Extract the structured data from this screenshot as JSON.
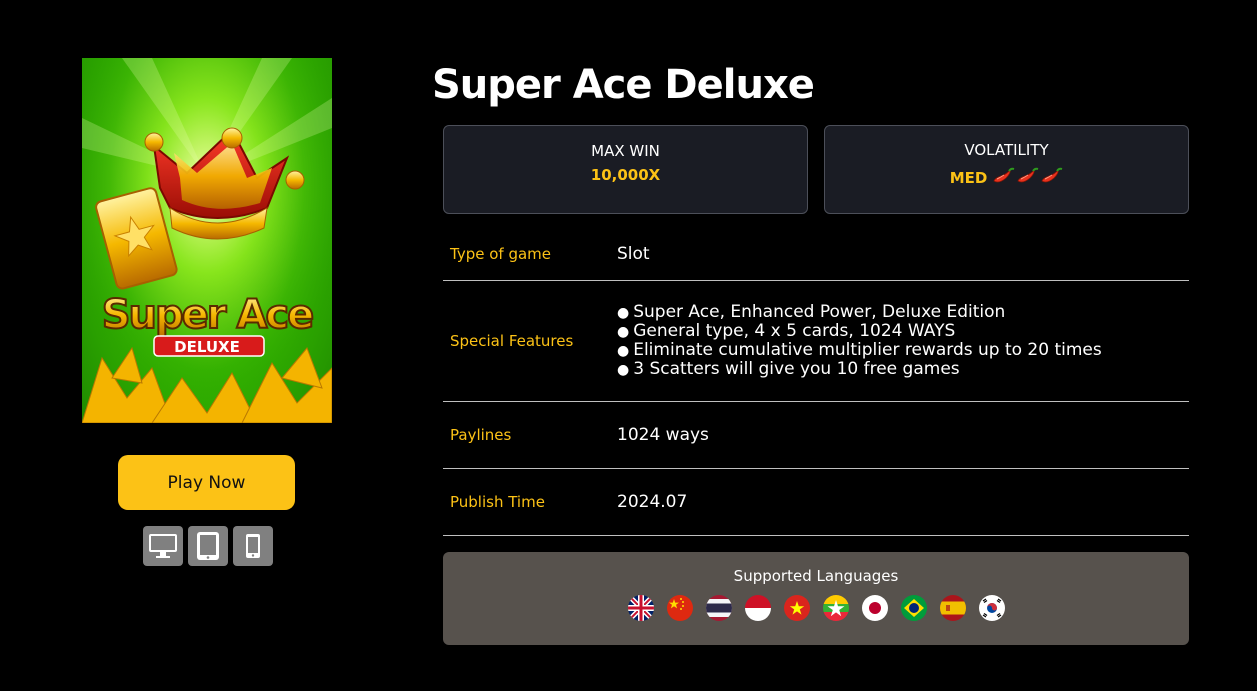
{
  "game": {
    "title": "Super Ace Deluxe",
    "cover_text_main": "Super Ace",
    "cover_text_sub": "DELUXE"
  },
  "actions": {
    "play_label": "Play Now"
  },
  "devices": [
    {
      "name": "desktop-icon"
    },
    {
      "name": "tablet-icon"
    },
    {
      "name": "mobile-icon"
    }
  ],
  "stats": {
    "max_win_label": "MAX WIN",
    "max_win_value": "10,000X",
    "volatility_label": "VOLATILITY",
    "volatility_value": "MED",
    "volatility_level": 3
  },
  "info": {
    "type_label": "Type of game",
    "type_value": "Slot",
    "features_label": "Special Features",
    "features": [
      "Super Ace, Enhanced Power, Deluxe Edition",
      "General type, 4 x 5 cards, 1024 WAYS",
      "Eliminate cumulative multiplier rewards up to 20 times",
      "3 Scatters will give you 10 free games"
    ],
    "paylines_label": "Paylines",
    "paylines_value": "1024 ways",
    "publish_label": "Publish Time",
    "publish_value": "2024.07"
  },
  "languages": {
    "title": "Supported Languages",
    "flags": [
      "uk-flag",
      "china-flag",
      "thailand-flag",
      "indonesia-flag",
      "vietnam-flag",
      "myanmar-flag",
      "japan-flag",
      "brazil-flag",
      "spain-flag",
      "korea-flag"
    ]
  },
  "colors": {
    "accent": "#fcc216",
    "card_bg": "#1a1c24",
    "lang_bg": "#57524d"
  }
}
